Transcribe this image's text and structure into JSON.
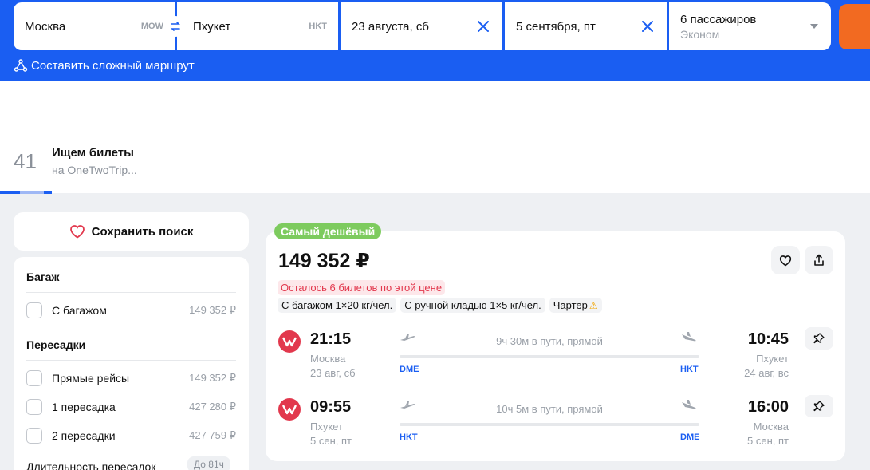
{
  "search": {
    "from_city": "Москва",
    "from_code": "MOW",
    "to_city": "Пхукет",
    "to_code": "HKT",
    "date_there": "23 августа, сб",
    "date_back": "5 сентября, пт",
    "passengers": "6 пассажиров",
    "cabin_class": "Эконом",
    "complex_route_label": "Составить сложный маршрут"
  },
  "searching": {
    "count": "41",
    "title": "Ищем билеты",
    "subtitle": "на OneTwoTrip..."
  },
  "sidebar": {
    "save_search_label": "Сохранить поиск",
    "baggage_heading": "Багаж",
    "baggage_options": [
      {
        "label": "С багажом",
        "price": "149 352 ₽"
      }
    ],
    "transfers_heading": "Пересадки",
    "transfer_options": [
      {
        "label": "Прямые рейсы",
        "price": "149 352 ₽"
      },
      {
        "label": "1 пересадка",
        "price": "427 280 ₽"
      },
      {
        "label": "2 пересадки",
        "price": "427 759 ₽"
      }
    ],
    "transfer_duration_label": "Длительность пересадок",
    "transfer_duration_value": "До 81ч"
  },
  "ticket": {
    "badge": "Самый дешёвый",
    "price": "149 352 ₽",
    "seats_left": "Осталось 6 билетов по этой цене",
    "tags": [
      "С багажом 1×20 кг/чел.",
      "С ручной кладью 1×5 кг/чел.",
      "Чартер"
    ],
    "segments": [
      {
        "dep_time": "21:15",
        "dep_city": "Москва",
        "dep_date": "23 авг, сб",
        "dep_code": "DME",
        "duration": "9ч 30м в пути, прямой",
        "arr_time": "10:45",
        "arr_city": "Пхукет",
        "arr_date": "24 авг, вс",
        "arr_code": "HKT"
      },
      {
        "dep_time": "09:55",
        "dep_city": "Пхукет",
        "dep_date": "5 сен, пт",
        "dep_code": "HKT",
        "duration": "10ч 5м в пути, прямой",
        "arr_time": "16:00",
        "arr_city": "Москва",
        "arr_date": "5 сен, пт",
        "arr_code": "DME"
      }
    ]
  },
  "colors": {
    "brand_blue": "#1a5ef2",
    "search_button": "#f26a21",
    "cheapest_badge": "#7dcb5e",
    "airline_red": "#e2384d"
  }
}
